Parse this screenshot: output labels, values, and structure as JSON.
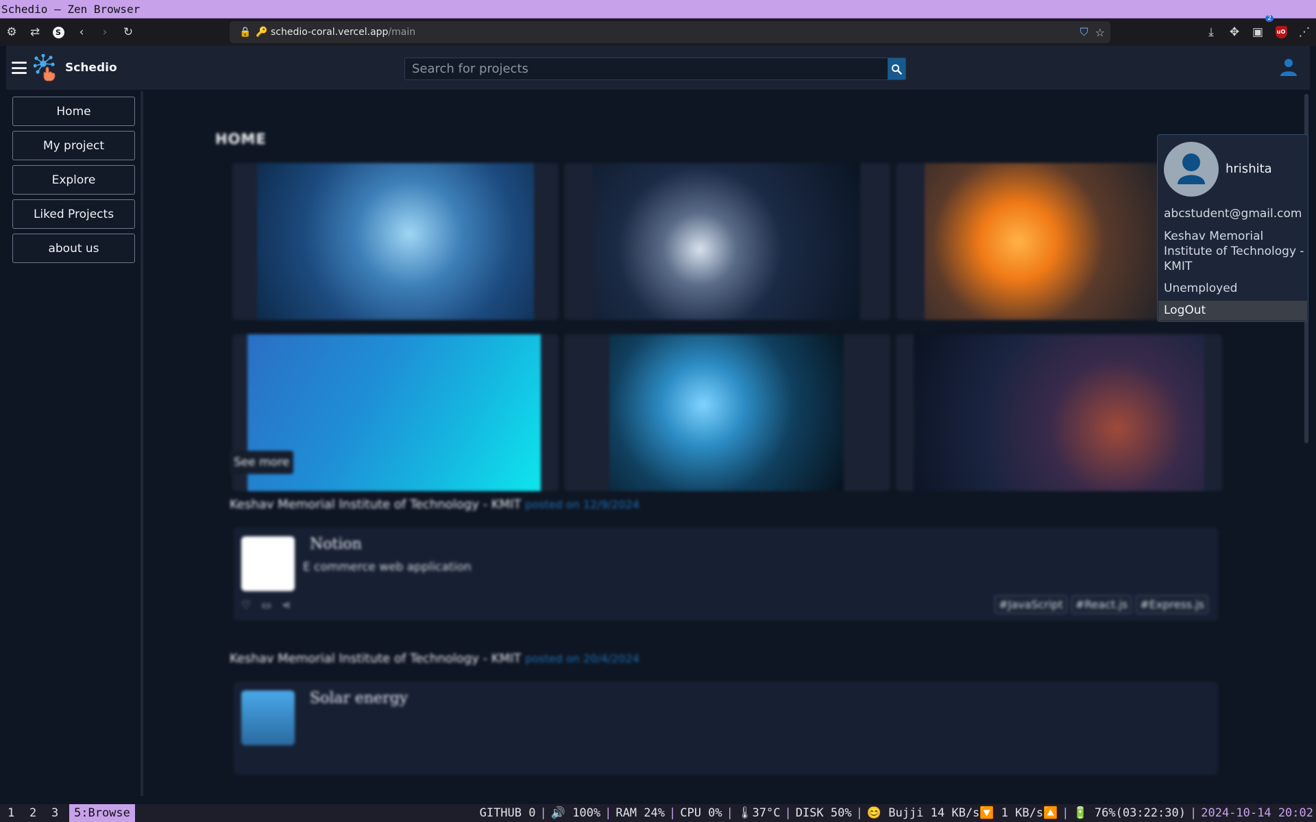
{
  "window": {
    "title": "Schedio — Zen Browser"
  },
  "browser": {
    "url_host": "schedio-coral.vercel.app",
    "url_path": "/main",
    "extension_badge": "2"
  },
  "app": {
    "brand": "Schedio",
    "search": {
      "placeholder": "Search for projects"
    },
    "sidebar": {
      "items": [
        {
          "label": "Home"
        },
        {
          "label": "My project"
        },
        {
          "label": "Explore"
        },
        {
          "label": "Liked Projects"
        },
        {
          "label": "about us"
        }
      ]
    },
    "main": {
      "title": "HOME",
      "see_more": "See more",
      "posts": [
        {
          "institute": "Keshav Memorial Institute of Technology - KMIT",
          "posted": "posted on 12/9/2024",
          "title": "Notion",
          "description": "E commerce web application",
          "tags": [
            "#JavaScript",
            "#React.js",
            "#Express.js"
          ]
        },
        {
          "institute": "Keshav Memorial Institute of Technology - KMIT",
          "posted": "posted on 20/4/2024",
          "title": "Solar energy"
        }
      ]
    },
    "profile": {
      "name": "hrishita",
      "email": "abcstudent@gmail.com",
      "college": "Keshav Memorial Institute of Technology - KMIT",
      "job": "Unemployed",
      "logout": "LogOut"
    }
  },
  "statusbar": {
    "workspaces": [
      {
        "label": "1",
        "active": false
      },
      {
        "label": "2",
        "active": false
      },
      {
        "label": "3",
        "active": false
      },
      {
        "label": "5:Browse",
        "active": true
      }
    ],
    "github": "GITHUB 0",
    "volume": "🔊 100%",
    "ram": "RAM 24%",
    "cpu": "CPU 0%",
    "temp": "🌡37°C",
    "disk": "DISK 50%",
    "network": "😊 Bujji 14 KB/s🔽 1 KB/s🔼",
    "battery": "🔋 76%(03:22:30)",
    "datetime": "2024-10-14 20:02"
  },
  "colors": {
    "accent": "#c7a2ea",
    "app_bg": "#0f1623",
    "header_bg": "#1b2333",
    "link": "#1d6fb5"
  }
}
